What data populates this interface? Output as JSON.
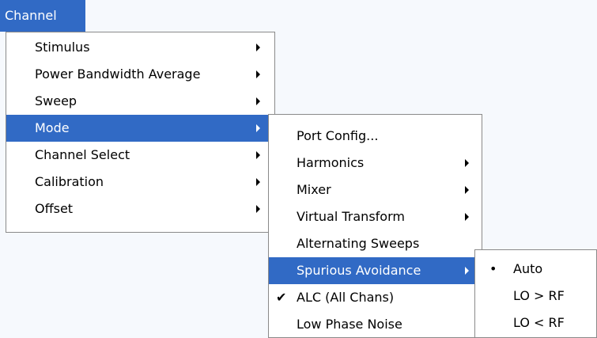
{
  "menubar": {
    "title": "Channel",
    "color": "#316ac5"
  },
  "channel_menu": {
    "items": [
      {
        "label": "Stimulus",
        "submenu": true
      },
      {
        "label": "Power Bandwidth Average",
        "submenu": true
      },
      {
        "label": "Sweep",
        "submenu": true
      },
      {
        "label": "Mode",
        "submenu": true,
        "highlighted": true
      },
      {
        "label": "Channel Select",
        "submenu": true
      },
      {
        "label": "Calibration",
        "submenu": true
      },
      {
        "label": "Offset",
        "submenu": true
      }
    ]
  },
  "mode_menu": {
    "items": [
      {
        "label": "Port Config...",
        "submenu": false
      },
      {
        "label": "Harmonics",
        "submenu": true
      },
      {
        "label": "Mixer",
        "submenu": true
      },
      {
        "label": "Virtual Transform",
        "submenu": true
      },
      {
        "label": "Alternating Sweeps",
        "submenu": false
      },
      {
        "label": "Spurious Avoidance",
        "submenu": true,
        "highlighted": true
      },
      {
        "label": "ALC (All Chans)",
        "submenu": false,
        "checked": true,
        "check_glyph": "✔"
      },
      {
        "label": "Low Phase Noise",
        "submenu": false
      }
    ]
  },
  "spurious_menu": {
    "items": [
      {
        "label": "Auto",
        "selected": true,
        "bullet_glyph": "•"
      },
      {
        "label": "LO > RF"
      },
      {
        "label": "LO < RF"
      }
    ]
  }
}
